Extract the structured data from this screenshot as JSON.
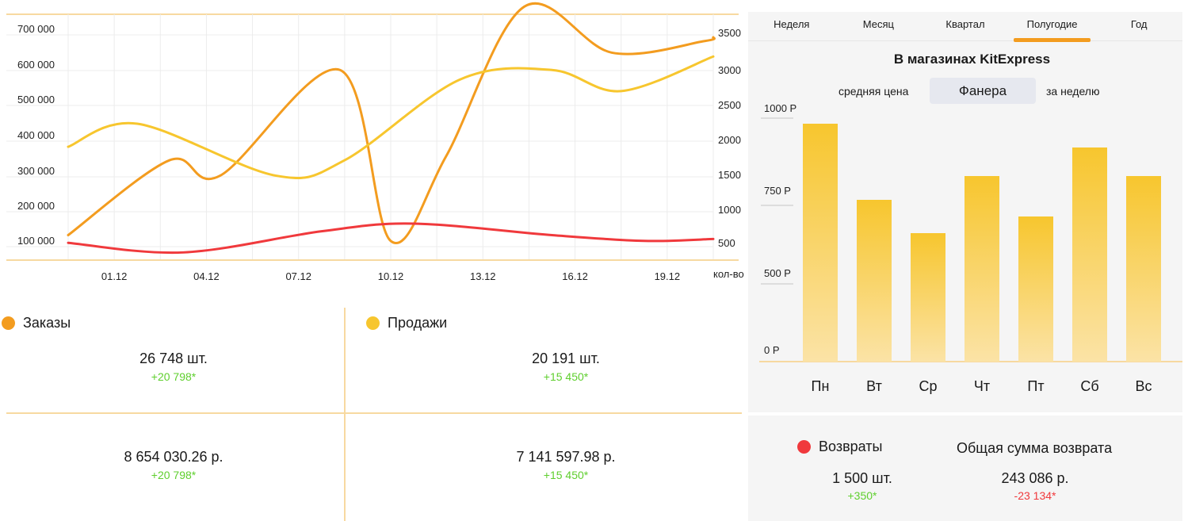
{
  "chart_data": [
    {
      "type": "line",
      "x": [
        "",
        "01.12",
        "",
        "04.12",
        "",
        "07.12",
        "",
        "10.12",
        "",
        "13.12",
        "",
        "16.12",
        "",
        "19.12",
        ""
      ],
      "categories_shown": [
        "01.12",
        "04.12",
        "07.12",
        "10.12",
        "13.12",
        "16.12",
        "19.12"
      ],
      "y_left_ticks": [
        "700 000",
        "600 000",
        "500 000",
        "400 000",
        "300 000",
        "200 000",
        "100 000"
      ],
      "y_right_ticks": [
        "3500",
        "3000",
        "2500",
        "2000",
        "1500",
        "1000",
        "500"
      ],
      "y_right_label": "кол-во",
      "ylim_left": [
        80000,
        720000
      ],
      "series": [
        {
          "name": "Заказы",
          "color": "#f39c1f",
          "axis": "left",
          "x": [
            0,
            2.2,
            3.3,
            5.9,
            7,
            8.2,
            9.9,
            11.8,
            13.8,
            14
          ],
          "values": [
            145000,
            340000,
            300000,
            575000,
            130000,
            350000,
            740000,
            620000,
            650000,
            660000
          ]
        },
        {
          "name": "Продажи",
          "color": "#f7c62e",
          "axis": "left",
          "x": [
            0,
            1.5,
            4.5,
            6,
            8.5,
            10.5,
            12,
            14
          ],
          "values": [
            375000,
            435000,
            300000,
            340000,
            550000,
            575000,
            520000,
            610000
          ]
        },
        {
          "name": "Возвраты",
          "color": "#f0393c",
          "axis": "left",
          "x": [
            0,
            2.5,
            5.5,
            7.5,
            10.5,
            12.5,
            14
          ],
          "values": [
            125000,
            100000,
            155000,
            175000,
            145000,
            130000,
            135000
          ]
        }
      ]
    },
    {
      "type": "bar",
      "title": "В магазинах KitExpress",
      "categories": [
        "Пн",
        "Вт",
        "Ср",
        "Чт",
        "Пт",
        "Сб",
        "Вс"
      ],
      "values": [
        1000,
        680,
        540,
        780,
        610,
        900,
        780
      ],
      "y_ticks": [
        "1000 Р",
        "750 Р",
        "500 Р",
        "0 Р"
      ],
      "ylim": [
        0,
        1000
      ],
      "bar_color_top": "#f7c62e",
      "bar_color_bottom": "#fbe3a6"
    }
  ],
  "period_tabs": [
    "Неделя",
    "Месяц",
    "Квартал",
    "Полугодие",
    "Год"
  ],
  "active_tab": "Полугодие",
  "kitexpress": {
    "title": "В магазинах KitExpress",
    "avg_price_label": "средняя цена",
    "product": "Фанера",
    "period_label": "за неделю"
  },
  "orders": {
    "label": "Заказы",
    "color": "#f39c1f",
    "count": "26 748 шт.",
    "count_delta": "+20 798*",
    "sum": "8 654 030.26 р.",
    "sum_delta": "+20 798*"
  },
  "sales": {
    "label": "Продажи",
    "color": "#f7c62e",
    "count": "20 191 шт.",
    "count_delta": "+15 450*",
    "sum": "7 141 597.98 р.",
    "sum_delta": "+15 450*"
  },
  "returns": {
    "label": "Возвраты",
    "color": "#f0393c",
    "count": "1 500 шт.",
    "count_delta": "+350*",
    "sum_label": "Общая сумма возврата",
    "sum": "243 086 р.",
    "sum_delta": "-23 134*"
  }
}
